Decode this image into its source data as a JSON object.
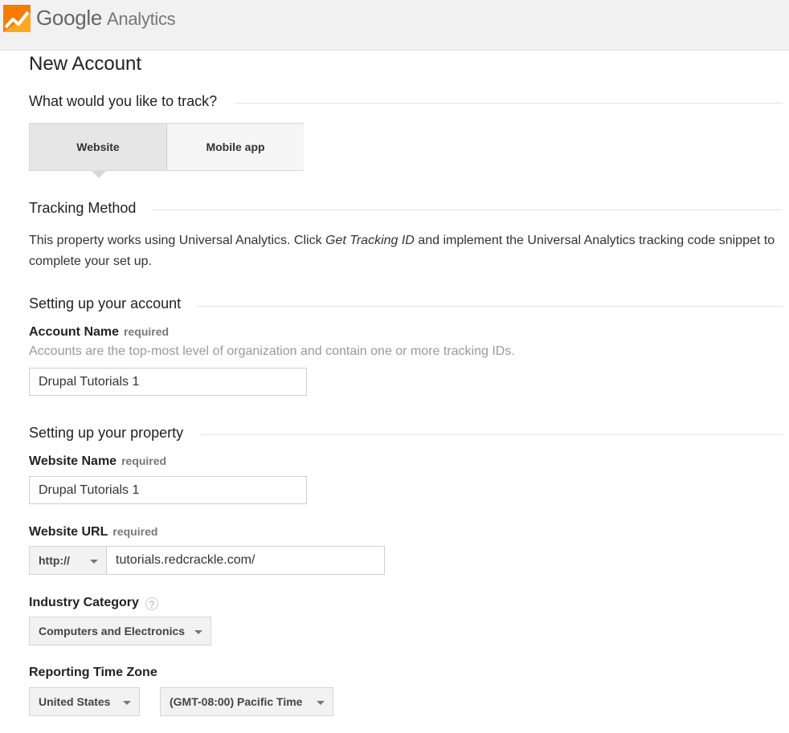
{
  "header": {
    "brand_google": "Google",
    "brand_product": "Analytics"
  },
  "page_title": "New Account",
  "track": {
    "heading": "What would you like to track?",
    "options": [
      "Website",
      "Mobile app"
    ],
    "selected": "Website"
  },
  "tracking_method": {
    "heading": "Tracking Method",
    "text_before": "This property works using Universal Analytics. Click ",
    "text_emph": "Get Tracking ID",
    "text_after": " and implement the Universal Analytics tracking code snippet to complete your set up."
  },
  "account": {
    "heading": "Setting up your account",
    "name_label": "Account Name",
    "required": "required",
    "hint": "Accounts are the top-most level of organization and contain one or more tracking IDs.",
    "name_value": "Drupal Tutorials 1"
  },
  "property": {
    "heading": "Setting up your property",
    "website_name_label": "Website Name",
    "website_name_value": "Drupal Tutorials 1",
    "website_url_label": "Website URL",
    "protocol": "http://",
    "url_value": "tutorials.redcrackle.com/",
    "industry_label": "Industry Category",
    "industry_help": "?",
    "industry_value": "Computers and Electronics",
    "timezone_label": "Reporting Time Zone",
    "country_value": "United States",
    "timezone_value": "(GMT-08:00) Pacific Time"
  },
  "colors": {
    "logo_orange": "#f57c00",
    "logo_light": "#ffa726"
  }
}
